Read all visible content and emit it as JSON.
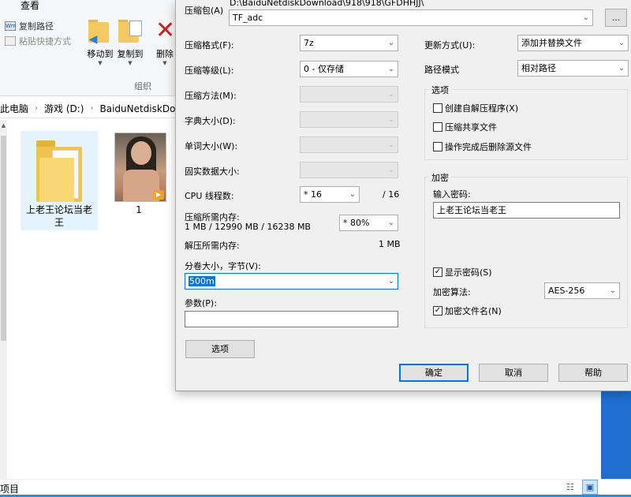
{
  "explorer": {
    "ribbon_tab": "查看",
    "commands": {
      "copy_path": "复制路径",
      "paste_shortcut": "粘贴快捷方式",
      "move_to": "移动到",
      "copy_to": "复制到",
      "delete": "删除",
      "group_label": "组织"
    },
    "address": {
      "this_pc": "此电脑",
      "drive": "游戏 (D:)",
      "folder": "BaiduNetdiskDow"
    },
    "files": [
      {
        "name": "上老王论坛当老王",
        "type": "folder"
      },
      {
        "name": "1",
        "type": "video"
      }
    ],
    "status": {
      "items": "项目"
    }
  },
  "dialog": {
    "archive_label": "压缩包(A)",
    "archive_path": "D:\\BaiduNetdiskDownload\\918\\918\\GFDHHJJ\\",
    "archive_name": "TF_adc",
    "browse_label": "...",
    "format_label": "压缩格式(F):",
    "format_value": "7z",
    "level_label": "压缩等级(L):",
    "level_value": "0 - 仅存储",
    "method_label": "压缩方法(M):",
    "dict_label": "字典大小(D):",
    "word_label": "单词大小(W):",
    "solid_label": "固实数据大小:",
    "cpu_label": "CPU 线程数:",
    "cpu_value": "* 16",
    "cpu_total": "/ 16",
    "mem_comp_label": "压缩所需内存:",
    "mem_comp_value": "1 MB / 12990 MB / 16238 MB",
    "mem_percent": "* 80%",
    "mem_decomp_label": "解压所需内存:",
    "mem_decomp_value": "1 MB",
    "volume_label": "分卷大小，字节(V):",
    "volume_value": "500m",
    "params_label": "参数(P):",
    "params_value": "",
    "options_button": "选项",
    "update_label": "更新方式(U):",
    "update_value": "添加并替换文件",
    "path_mode_label": "路径模式",
    "path_mode_value": "相对路径",
    "options_group": "选项",
    "opt_sfx": "创建自解压程序(X)",
    "opt_shared": "压缩共享文件",
    "opt_delete": "操作完成后删除源文件",
    "encryption_group": "加密",
    "password_label": "输入密码:",
    "password_value": "上老王论坛当老王",
    "show_password": "显示密码(S)",
    "enc_method_label": "加密算法:",
    "enc_method_value": "AES-256",
    "encrypt_names": "加密文件名(N)",
    "ok": "确定",
    "cancel": "取消",
    "help": "帮助",
    "checks": {
      "sfx": false,
      "shared": false,
      "delete": false,
      "show_password": true,
      "encrypt_names": true
    }
  }
}
